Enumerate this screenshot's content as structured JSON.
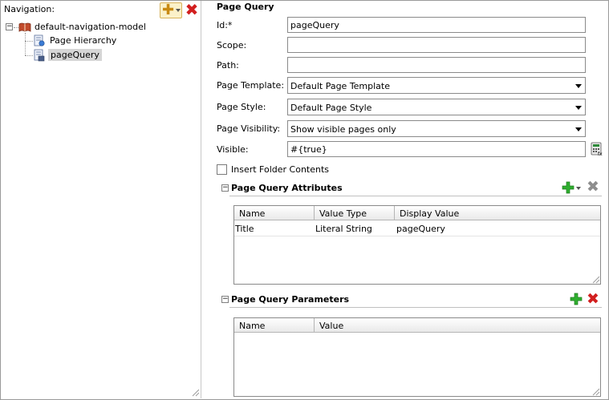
{
  "navigation": {
    "title": "Navigation:",
    "tree": {
      "root_label": "default-navigation-model",
      "children": [
        {
          "label": "Page Hierarchy"
        },
        {
          "label": "pageQuery",
          "selected": true
        }
      ]
    }
  },
  "page_query": {
    "section_title": "Page Query",
    "fields": {
      "id": {
        "label": "Id:*",
        "value": "pageQuery"
      },
      "scope": {
        "label": "Scope:",
        "value": ""
      },
      "path": {
        "label": "Path:",
        "value": ""
      },
      "page_template": {
        "label": "Page Template:",
        "value": "Default Page Template"
      },
      "page_style": {
        "label": "Page Style:",
        "value": "Default Page Style"
      },
      "page_visibility": {
        "label": "Page Visibility:",
        "value": "Show visible pages only"
      },
      "visible": {
        "label": "Visible:",
        "value": "#{true}"
      }
    },
    "insert_folder_contents": {
      "label": "Insert Folder Contents",
      "checked": false
    }
  },
  "attributes": {
    "title": "Page Query Attributes",
    "columns": [
      "Name",
      "Value Type",
      "Display Value"
    ],
    "rows": [
      {
        "name": "Title",
        "value_type": "Literal String",
        "display_value": "pageQuery"
      }
    ]
  },
  "parameters": {
    "title": "Page Query Parameters",
    "columns": [
      "Name",
      "Value"
    ],
    "rows": []
  },
  "colors": {
    "add_green": "#2fae2f",
    "delete_red": "#d21f1f",
    "selection_bg": "#d6d6d6"
  }
}
